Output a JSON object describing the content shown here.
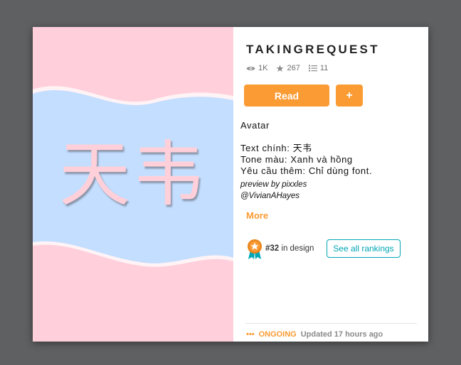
{
  "story": {
    "title": "TAKINGREQUEST",
    "cover_text": "天韦"
  },
  "stats": {
    "reads": "1K",
    "votes": "267",
    "parts": "11"
  },
  "actions": {
    "read_label": "Read",
    "add_label": "+"
  },
  "description": {
    "line1": "Avatar",
    "line2": "Text chính: 天韦",
    "line3": "Tone màu: Xanh và hồng",
    "line4": "Yêu cầu thêm: Chỉ dùng font.",
    "credit1": "preview by pixxles",
    "credit2": "@VivianAHayes",
    "more_label": "More"
  },
  "ranking": {
    "rank": "#32",
    "in_text": " in design",
    "see_all_label": "See all rankings"
  },
  "status": {
    "dots": "•••",
    "state": "ONGOING",
    "updated": "Updated 17 hours ago"
  },
  "colors": {
    "accent": "#fb9b33",
    "teal": "#00a6b5",
    "cover_pink": "#ffcfdb",
    "cover_blue": "#c3deff"
  },
  "icons": {
    "reads": "eye-icon",
    "votes": "star-icon",
    "parts": "list-icon",
    "rank": "ribbon-badge-icon"
  }
}
